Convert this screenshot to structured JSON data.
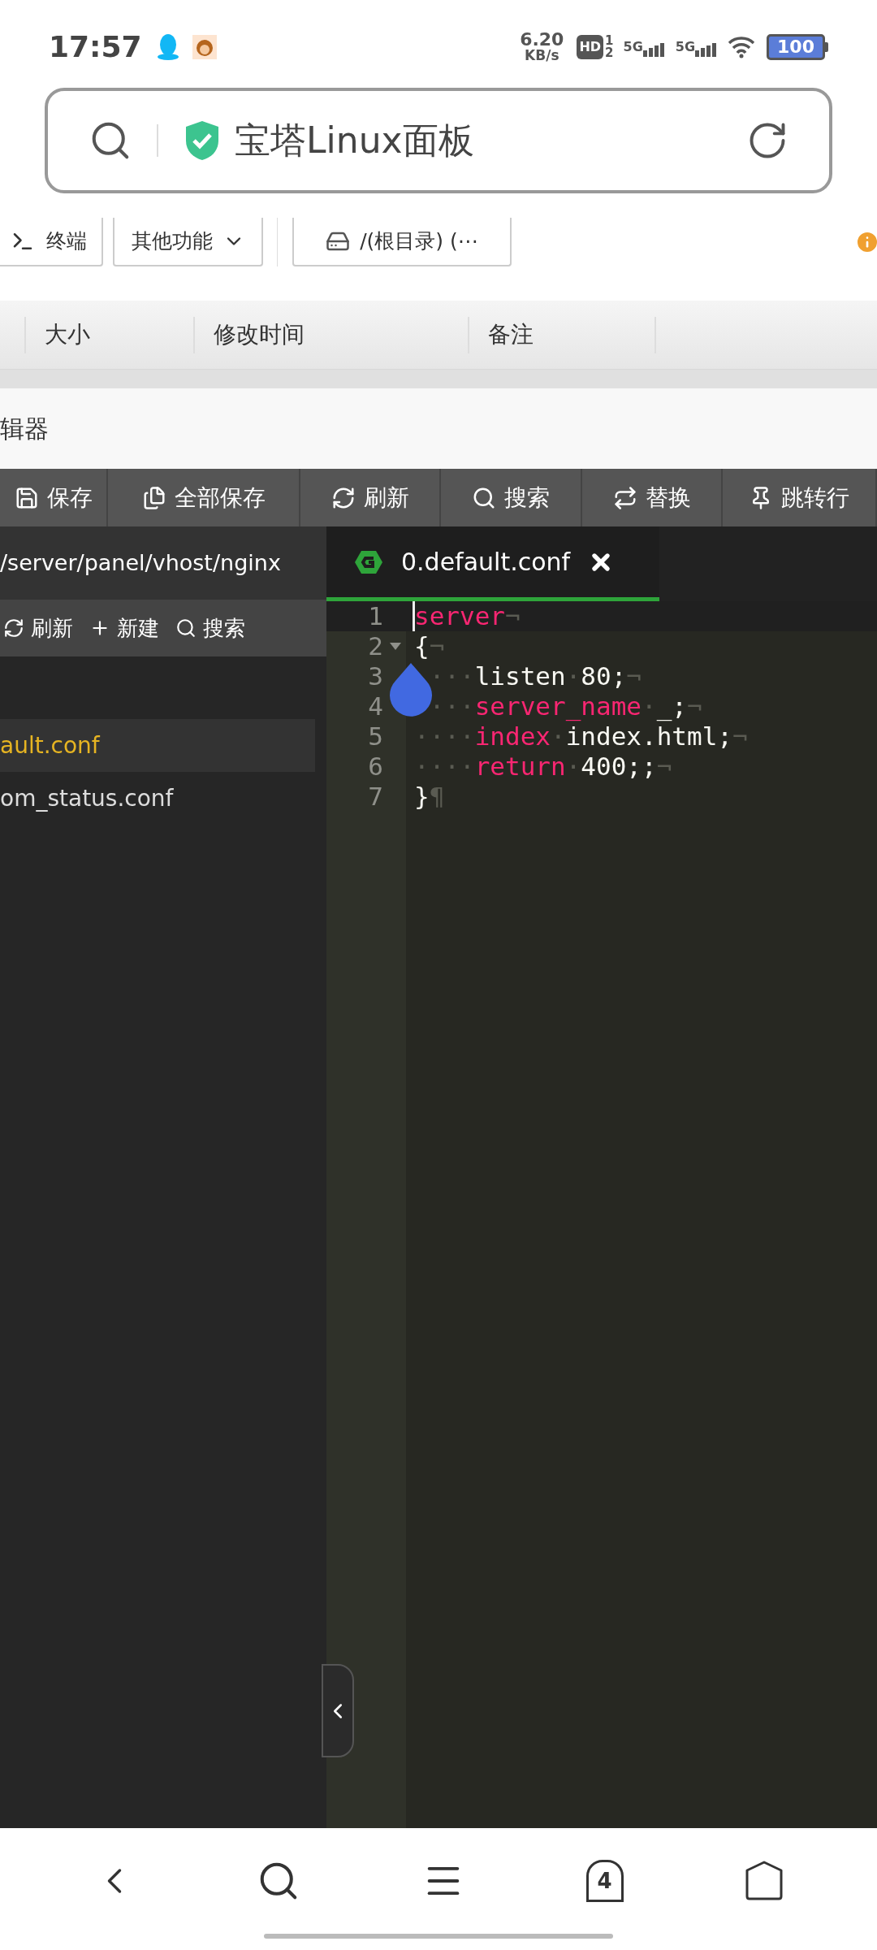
{
  "status_bar": {
    "time": "17:57",
    "speed": "6.20",
    "speed_unit": "KB/s",
    "hd": "HD",
    "sim_1": "1",
    "sim_2": "2",
    "network_1": "5G",
    "network_2": "5G",
    "battery": "100"
  },
  "address_bar": {
    "title": "宝塔Linux面板"
  },
  "file_toolbar": [
    {
      "kind": "terminal",
      "label": "终端"
    },
    {
      "kind": "dropdown",
      "label": "其他功能"
    },
    {
      "kind": "drive",
      "label": "/(根目录) (⋯"
    }
  ],
  "table": {
    "columns": [
      "大小",
      "修改时间",
      "备注"
    ]
  },
  "editor": {
    "title": "辑器",
    "toolbar": [
      {
        "kind": "save",
        "label": "保存"
      },
      {
        "kind": "save_all",
        "label": "全部保存"
      },
      {
        "kind": "refresh",
        "label": "刷新"
      },
      {
        "kind": "search",
        "label": "搜索"
      },
      {
        "kind": "replace",
        "label": "替换"
      },
      {
        "kind": "goto",
        "label": "跳转行"
      }
    ],
    "sidebar": {
      "path": "/server/panel/vhost/nginx",
      "actions": [
        {
          "kind": "refresh",
          "label": "刷新"
        },
        {
          "kind": "new",
          "label": "新建"
        },
        {
          "kind": "search",
          "label": "搜索"
        }
      ],
      "files": [
        {
          "name": "ault.conf",
          "selected": true
        },
        {
          "name": "om_status.conf",
          "selected": false
        }
      ]
    },
    "tabs": [
      {
        "label": "0.default.conf",
        "selected": true
      }
    ],
    "lines": [
      {
        "number": "1",
        "fold": false,
        "active": true,
        "tokens": [
          {
            "text": "server",
            "kind": "keyword"
          },
          {
            "text": "¬",
            "kind": "invisible"
          }
        ]
      },
      {
        "number": "2",
        "fold": true,
        "active": false,
        "tokens": [
          {
            "text": "{",
            "kind": "plain"
          },
          {
            "text": "¬",
            "kind": "invisible"
          }
        ]
      },
      {
        "number": "3",
        "fold": false,
        "active": false,
        "handle": true,
        "tokens": [
          {
            "text": "···",
            "kind": "shifted"
          },
          {
            "text": "listen",
            "kind": "plain"
          },
          {
            "text": "·",
            "kind": "invisible"
          },
          {
            "text": "80;",
            "kind": "plain"
          },
          {
            "text": "¬",
            "kind": "invisible"
          }
        ]
      },
      {
        "number": "4",
        "fold": false,
        "active": false,
        "tokens": [
          {
            "text": "···",
            "kind": "shifted"
          },
          {
            "text": "server_name",
            "kind": "keyword"
          },
          {
            "text": "·",
            "kind": "invisible"
          },
          {
            "text": "_;",
            "kind": "plain"
          },
          {
            "text": "¬",
            "kind": "invisible"
          }
        ]
      },
      {
        "number": "5",
        "fold": false,
        "active": false,
        "tokens": [
          {
            "text": "····",
            "kind": "invisible"
          },
          {
            "text": "index",
            "kind": "keyword"
          },
          {
            "text": "·",
            "kind": "invisible"
          },
          {
            "text": "index.html;",
            "kind": "plain"
          },
          {
            "text": "¬",
            "kind": "invisible"
          }
        ]
      },
      {
        "number": "6",
        "fold": false,
        "active": false,
        "tokens": [
          {
            "text": "····",
            "kind": "invisible"
          },
          {
            "text": "return",
            "kind": "keyword"
          },
          {
            "text": "·",
            "kind": "invisible"
          },
          {
            "text": "400;;",
            "kind": "plain"
          },
          {
            "text": "¬",
            "kind": "invisible"
          }
        ]
      },
      {
        "number": "7",
        "fold": false,
        "active": false,
        "tokens": [
          {
            "text": "}",
            "kind": "plain"
          },
          {
            "text": "¶",
            "kind": "invisible"
          }
        ]
      }
    ]
  },
  "bottom_nav": {
    "tab_count": "4"
  }
}
